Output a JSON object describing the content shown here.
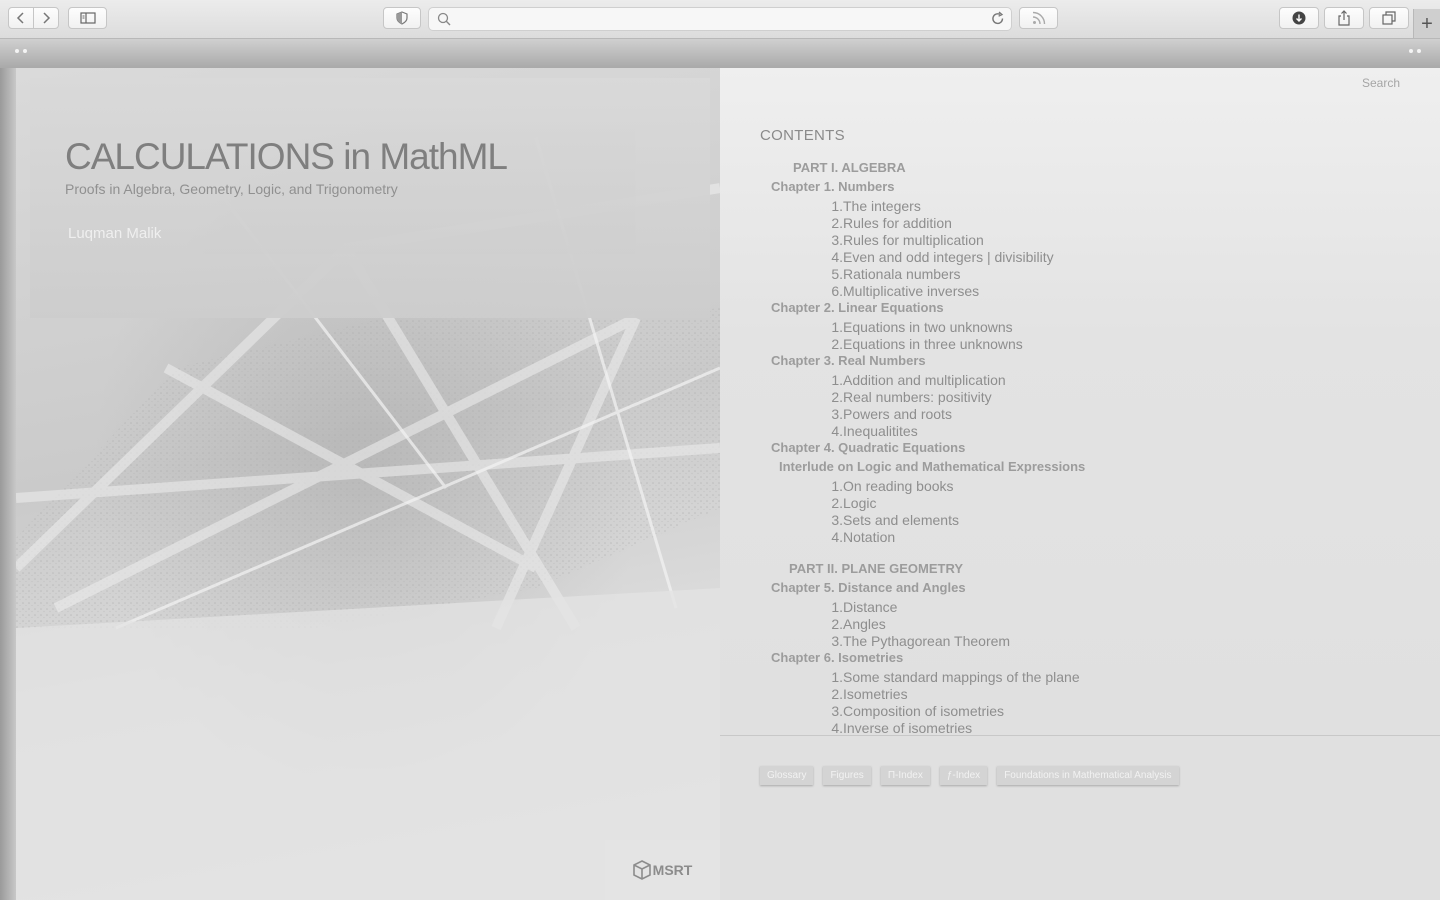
{
  "browser": {
    "address_value": "",
    "new_tab_label": "+"
  },
  "cover": {
    "title": "CALCULATIONS in MathML",
    "subtitle": "Proofs in Algebra, Geometry, Logic, and Trigonometry",
    "author": "Luqman Malik",
    "publisher": "MSRT"
  },
  "toc": {
    "search_label": "Search",
    "heading": "CONTENTS",
    "entries": [
      {
        "kind": "part",
        "label": "PART I.  ALGEBRA"
      },
      {
        "kind": "chapter",
        "label": "Chapter 1.  Numbers"
      },
      {
        "kind": "section",
        "num": "1.",
        "label": "The integers"
      },
      {
        "kind": "section",
        "num": "2.",
        "label": "Rules for addition"
      },
      {
        "kind": "section",
        "num": "3.",
        "label": "Rules for multiplication"
      },
      {
        "kind": "section",
        "num": "4.",
        "label": "Even and odd integers | divisibility"
      },
      {
        "kind": "section",
        "num": "5.",
        "label": "Rationala numbers"
      },
      {
        "kind": "section",
        "num": "6.",
        "label": "Multiplicative inverses"
      },
      {
        "kind": "chapter",
        "label": "Chapter 2.  Linear Equations"
      },
      {
        "kind": "section",
        "num": "1.",
        "label": "Equations in two unknowns"
      },
      {
        "kind": "section",
        "num": "2.",
        "label": "Equations in three unknowns"
      },
      {
        "kind": "chapter",
        "label": "Chapter 3.  Real Numbers"
      },
      {
        "kind": "section",
        "num": "1.",
        "label": "Addition and multiplication"
      },
      {
        "kind": "section",
        "num": "2.",
        "label": "Real numbers: positivity"
      },
      {
        "kind": "section",
        "num": "3.",
        "label": "Powers and roots"
      },
      {
        "kind": "section",
        "num": "4.",
        "label": "Inequalitites"
      },
      {
        "kind": "chapter",
        "label": "Chapter 4.  Quadratic Equations"
      },
      {
        "kind": "interlude",
        "label": "Interlude on Logic and Mathematical Expressions"
      },
      {
        "kind": "section",
        "num": "1.",
        "label": "On reading books"
      },
      {
        "kind": "section",
        "num": "2.",
        "label": "Logic"
      },
      {
        "kind": "section",
        "num": "3.",
        "label": "Sets and elements"
      },
      {
        "kind": "section",
        "num": "4.",
        "label": "Notation"
      },
      {
        "kind": "part",
        "label": "PART II.  PLANE GEOMETRY"
      },
      {
        "kind": "chapter",
        "label": "Chapter 5.  Distance and Angles"
      },
      {
        "kind": "section",
        "num": "1.",
        "label": "Distance"
      },
      {
        "kind": "section",
        "num": "2.",
        "label": "Angles"
      },
      {
        "kind": "section",
        "num": "3.",
        "label": "The Pythagorean Theorem"
      },
      {
        "kind": "chapter",
        "label": "Chapter 6.  Isometries"
      },
      {
        "kind": "section",
        "num": "1.",
        "label": "Some standard mappings of the plane"
      },
      {
        "kind": "section",
        "num": "2.",
        "label": "Isometries"
      },
      {
        "kind": "section",
        "num": "3.",
        "label": "Composition of isometries"
      },
      {
        "kind": "section",
        "num": "4.",
        "label": "Inverse of isometries"
      }
    ]
  },
  "links": [
    "Glossary",
    "Figures",
    "Π-Index",
    "ƒ-Index",
    "Foundations in Mathematical Analysis"
  ]
}
